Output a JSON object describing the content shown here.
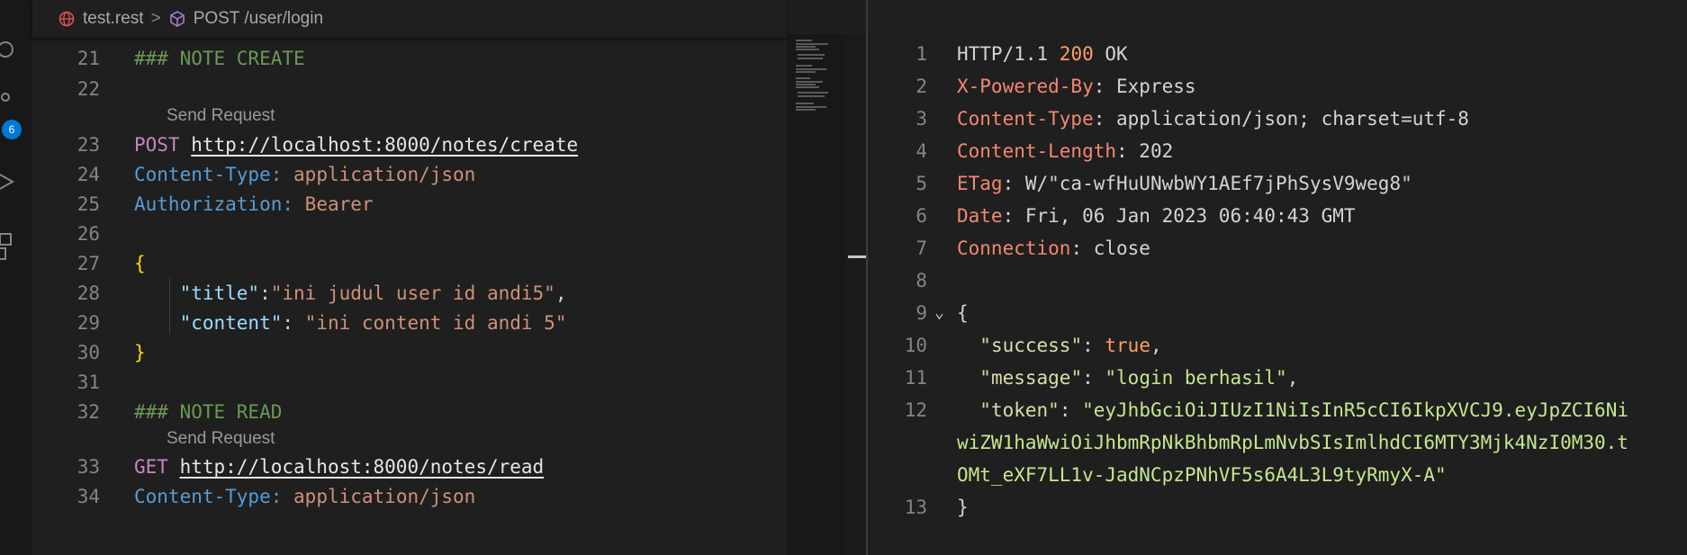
{
  "breadcrumb": {
    "file": "test.rest",
    "separator": ">",
    "request": "POST /user/login",
    "file_icon": "globe-icon",
    "request_icon": "cube-icon"
  },
  "activity_bar": {
    "badge_count": "6"
  },
  "request_editor": {
    "codelens_label": "Send Request",
    "lines": [
      {
        "num": "21",
        "comment": "### NOTE CREATE"
      },
      {
        "num": "22"
      },
      {
        "num": "23",
        "method": "POST",
        "url": "http://localhost:8000/notes/create"
      },
      {
        "num": "24",
        "hkey": "Content-Type:",
        "hval": "application/json"
      },
      {
        "num": "25",
        "hkey": "Authorization:",
        "hval": "Bearer"
      },
      {
        "num": "26"
      },
      {
        "num": "27",
        "brace": "{"
      },
      {
        "num": "28",
        "jkey": "\"title\"",
        "sep": ":",
        "jval": "\"ini judul user id andi5\"",
        "trail": ","
      },
      {
        "num": "29",
        "jkey": "\"content\"",
        "sep": ": ",
        "jval": "\"ini content id andi 5\""
      },
      {
        "num": "30",
        "brace": "}"
      },
      {
        "num": "31"
      },
      {
        "num": "32",
        "comment": "### NOTE READ"
      },
      {
        "num": "33",
        "method": "GET",
        "url": "http://localhost:8000/notes/read"
      },
      {
        "num": "34",
        "hkey": "Content-Type:",
        "hval": "application/json"
      }
    ]
  },
  "response_editor": {
    "lines": [
      {
        "num": "1",
        "status_pre": "HTTP/1.1 ",
        "status_code": "200",
        "status_post": " OK"
      },
      {
        "num": "2",
        "hkey": "X-Powered-By",
        "hval": ": Express"
      },
      {
        "num": "3",
        "hkey": "Content-Type",
        "hval": ": application/json; charset=utf-8"
      },
      {
        "num": "4",
        "hkey": "Content-Length",
        "hval": ": 202"
      },
      {
        "num": "5",
        "hkey": "ETag",
        "hval": ": W/\"ca-wfHuUNwbWY1AEf7jPhSysV9weg8\""
      },
      {
        "num": "6",
        "hkey": "Date",
        "hval": ": Fri, 06 Jan 2023 06:40:43 GMT"
      },
      {
        "num": "7",
        "hkey": "Connection",
        "hval": ": close"
      },
      {
        "num": "8"
      },
      {
        "num": "9",
        "brace": "{",
        "fold": "chevron-down-icon"
      },
      {
        "num": "10",
        "jkey": "\"success\"",
        "jbool": "true"
      },
      {
        "num": "11",
        "jkey": "\"message\"",
        "jstr": "\"login berhasil\""
      },
      {
        "num": "12",
        "jkey": "\"token\"",
        "jstr": "\"eyJhbGciOiJIUzI1NiIsInR5cCI6IkpXVCJ9.eyJpZCI6Ni"
      },
      {
        "num": "",
        "jstr": "wiZW1haWwiOiJhbmRpNkBhbmRpLmNvbSIsImlhdCI6MTY3Mjk4NzI0M30.t"
      },
      {
        "num": "",
        "jstr": "OMt_eXF7LL1v-JadNCpzPNhVF5s6A4L3L9tyRmyX-A\""
      },
      {
        "num": "13",
        "brace": "}"
      }
    ]
  }
}
